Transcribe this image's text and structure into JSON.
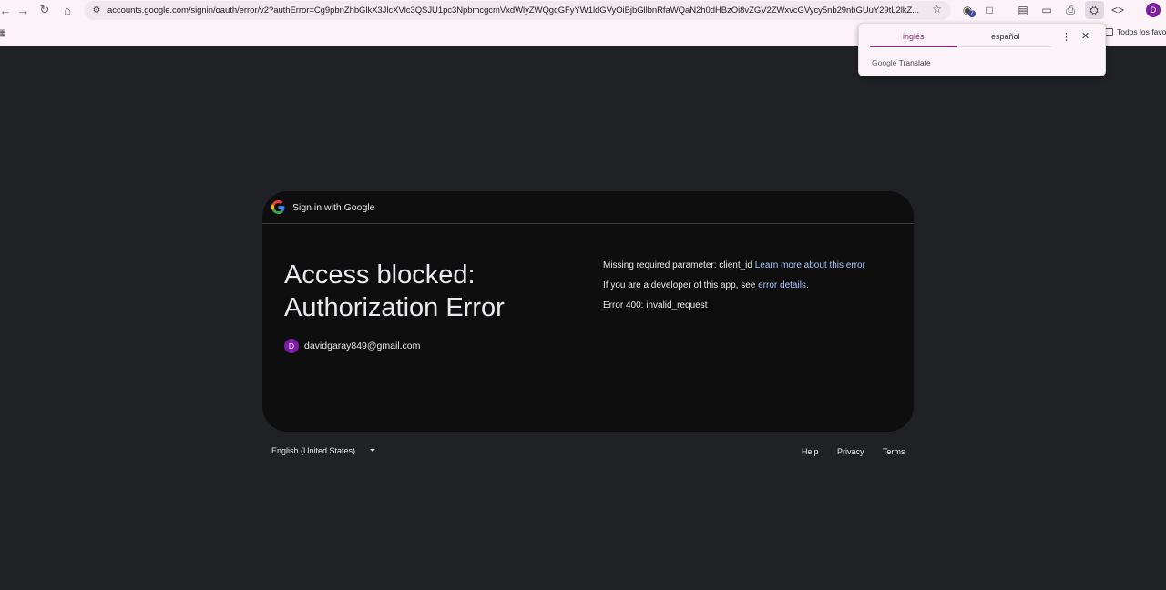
{
  "browser": {
    "url": "accounts.google.com/signin/oauth/error/v2?authError=Cg9pbnZhbGlkX3JlcXVlc3QSJU1pc3NpbmcgcmVxdWlyZWQgcGFyYW1ldGVyOiBjbGllbnRfaWQaN2h0dHBzOi8vZGV2ZWxvcGVycy5nb29nbGUuY29tL2lkZ...",
    "extension_badge": "7",
    "profile_initial": "D",
    "bookmarks_folder": "Todos los favo"
  },
  "translate_popup": {
    "tabs": [
      "inglés",
      "español"
    ],
    "active_tab": "inglés",
    "footer_brand": "Google",
    "footer_product": "Translate"
  },
  "card": {
    "header_title": "Sign in with Google",
    "headline_line1": "Access blocked:",
    "headline_line2": "Authorization Error",
    "avatar_initial": "D",
    "email": "davidgaray849@gmail.com",
    "error_param_text": "Missing required parameter: client_id",
    "learn_more_link": "Learn more about this error",
    "developer_text": "If you are a developer of this app, see",
    "error_details_link": "error details",
    "developer_text_end": ".",
    "error_code": "Error 400: invalid_request"
  },
  "footer": {
    "language": "English (United States)",
    "links": [
      "Help",
      "Privacy",
      "Terms"
    ]
  },
  "colors": {
    "page_bg": "#202124",
    "card_bg": "#0e0e0f",
    "link": "#a8c7fa",
    "avatar": "#7b1fa2",
    "translate_accent": "#8a2d7a"
  }
}
